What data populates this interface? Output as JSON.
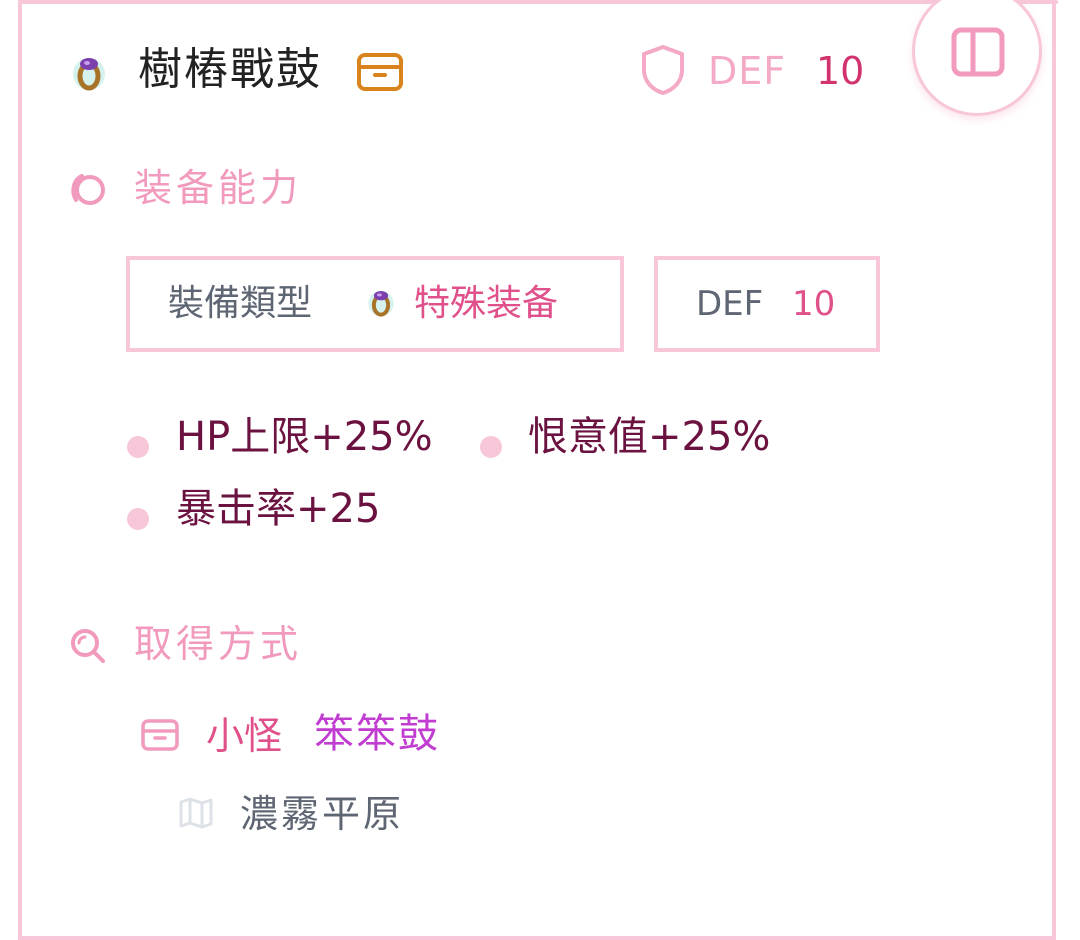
{
  "header": {
    "item_icon": "ring-icon",
    "title": "樹樁戰鼓",
    "category_icon": "box-icon",
    "shield_icon": "shield-icon",
    "def_label": "DEF",
    "def_value": "10",
    "layout_icon": "sidebar-layout-icon"
  },
  "ability_section": {
    "icon": "swirl-icon",
    "title": "装备能力",
    "type_chip": {
      "label": "裝備類型",
      "icon": "ring-icon",
      "value": "特殊装备"
    },
    "def_chip": {
      "label": "DEF",
      "value": "10"
    },
    "stats": [
      "HP上限+25%",
      "恨意值+25%",
      "暴击率+25"
    ]
  },
  "source_section": {
    "icon": "search-icon",
    "title": "取得方式",
    "source": {
      "icon": "box-icon",
      "type": "小怪",
      "name": "笨笨鼓"
    },
    "location": {
      "icon": "map-icon",
      "name": "濃霧平原"
    }
  },
  "colors": {
    "border": "#f7c6d8",
    "accent_pink": "#e0508a",
    "def_value": "#d2336f",
    "stat_text": "#6b1240",
    "monster_name": "#c13cd1",
    "category_icon": "#d9831f"
  }
}
